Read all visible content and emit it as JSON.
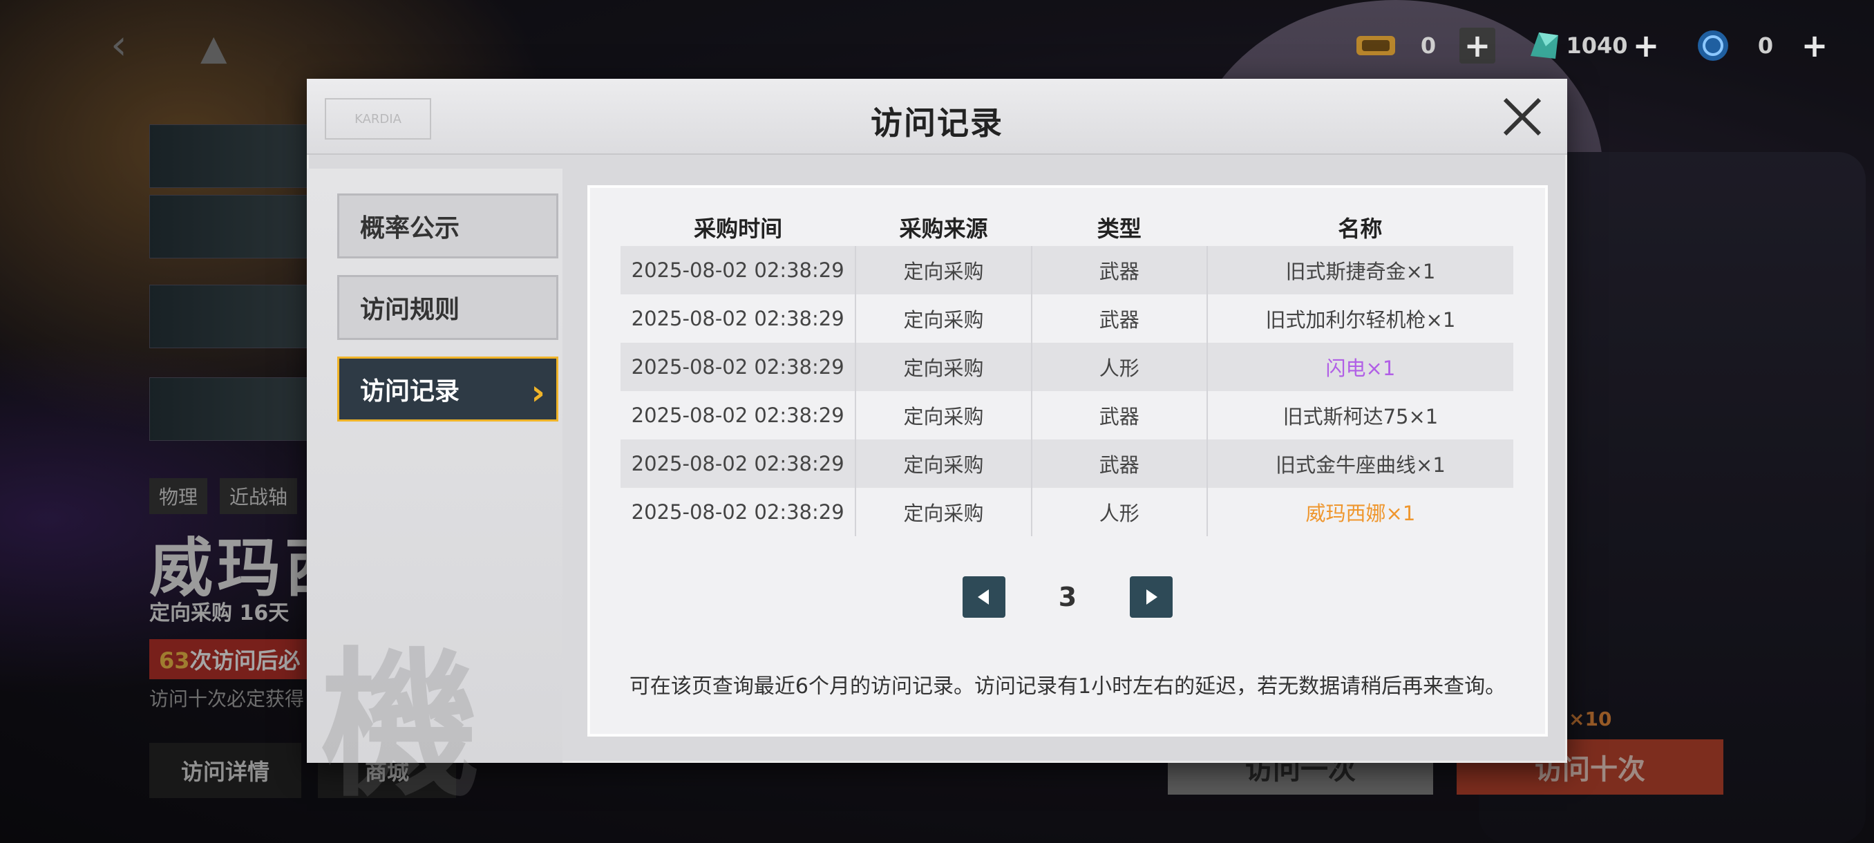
{
  "currencies": [
    {
      "icon": "ticket-icon",
      "value": "0"
    },
    {
      "icon": "crystal-icon",
      "value": "1040"
    },
    {
      "icon": "coin-icon",
      "value": "0"
    }
  ],
  "background": {
    "tag_element": "物理",
    "tag_type": "近战轴",
    "title": "威玛西",
    "subtitle": "定向采购 16天",
    "guarantee_count": "63",
    "guarantee_text": "次访问后必",
    "note": "访问十次必定获得",
    "btn_details": "访问详情",
    "btn_shop": "商城",
    "btn_once": "访问一次",
    "btn_ten": "访问十次",
    "ten_cost": "×10"
  },
  "modal": {
    "title": "访问记录",
    "logo_text": "KARDIA",
    "tabs": [
      "概率公示",
      "访问规则",
      "访问记录"
    ],
    "active_tab": 2,
    "watermark": "機",
    "columns": [
      "采购时间",
      "采购来源",
      "类型",
      "名称"
    ],
    "rows": [
      {
        "time": "2025-08-02 02:38:29",
        "source": "定向采购",
        "type": "武器",
        "name": "旧式斯捷奇金×1",
        "rarity": "normal"
      },
      {
        "time": "2025-08-02 02:38:29",
        "source": "定向采购",
        "type": "武器",
        "name": "旧式加利尔轻机枪×1",
        "rarity": "normal"
      },
      {
        "time": "2025-08-02 02:38:29",
        "source": "定向采购",
        "type": "人形",
        "name": "闪电×1",
        "rarity": "purple"
      },
      {
        "time": "2025-08-02 02:38:29",
        "source": "定向采购",
        "type": "武器",
        "name": "旧式斯柯达75×1",
        "rarity": "normal"
      },
      {
        "time": "2025-08-02 02:38:29",
        "source": "定向采购",
        "type": "武器",
        "name": "旧式金牛座曲线×1",
        "rarity": "normal"
      },
      {
        "time": "2025-08-02 02:38:29",
        "source": "定向采购",
        "type": "人形",
        "name": "威玛西娜×1",
        "rarity": "orange"
      }
    ],
    "page": "3",
    "note": "可在该页查询最近6个月的访问记录。访问记录有1小时左右的延迟，若无数据请稍后再来查询。",
    "colors": {
      "purple": "#b15fe6",
      "orange": "#ef962d",
      "accent": "#f0b429"
    }
  }
}
